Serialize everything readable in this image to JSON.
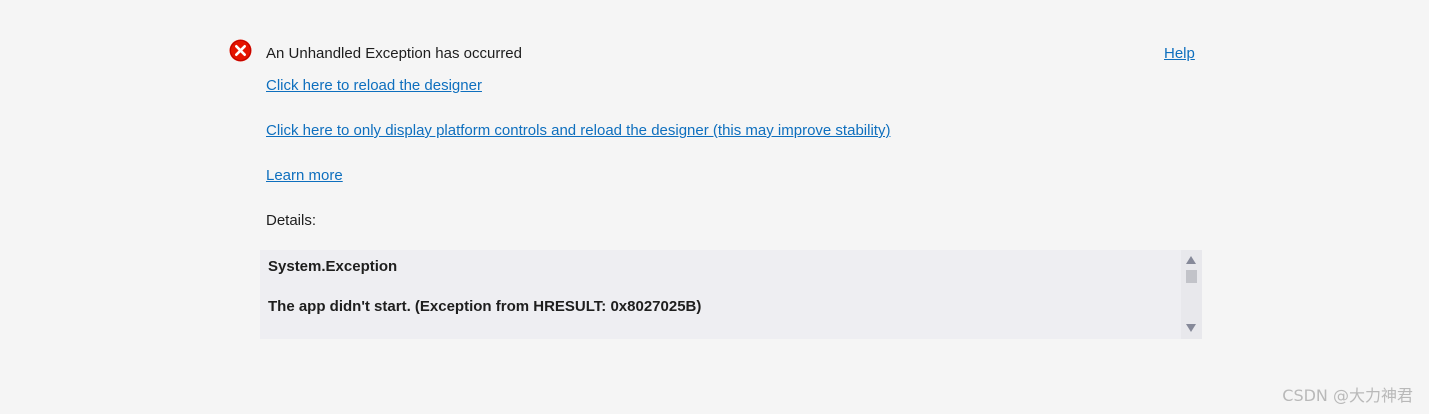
{
  "error": {
    "icon": "error-circle-x-icon",
    "icon_color": "#e51400",
    "title": "An Unhandled Exception has occurred",
    "help_label": "Help"
  },
  "links": {
    "reload": "Click here to reload the designer",
    "platform_only": "Click here to only display platform controls and reload the designer (this may improve stability)",
    "learn_more": "Learn more"
  },
  "details": {
    "label": "Details:",
    "exception_type": "System.Exception",
    "exception_message": "The app didn't start. (Exception from HRESULT: 0x8027025B)"
  },
  "colors": {
    "link": "#0e6fbe",
    "background": "#f5f5f5",
    "details_background": "#eeeef2"
  },
  "watermark": "CSDN @大力神君"
}
